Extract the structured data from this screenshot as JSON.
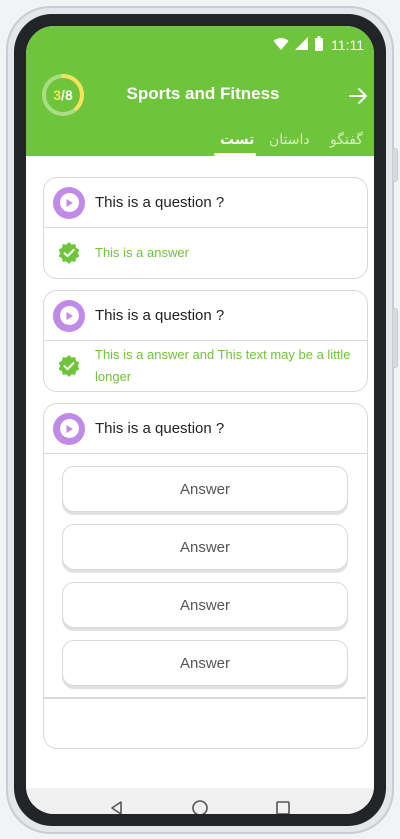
{
  "status_bar": {
    "time": "11:11",
    "icons": [
      "wifi-icon",
      "signal-icon",
      "battery-icon"
    ]
  },
  "header": {
    "progress": {
      "current": "3",
      "total": "8",
      "fraction": 0.375,
      "track_color": "#f7e25b"
    },
    "title": "Sports and Fitness",
    "next_icon": "arrow-right-icon"
  },
  "tabs": [
    {
      "label": "گفتگو",
      "active": false
    },
    {
      "label": "داستان",
      "active": false
    },
    {
      "label": "تست",
      "active": true
    }
  ],
  "cards": [
    {
      "question": "This is a question ?",
      "answer": "This is a answer",
      "answered": true
    },
    {
      "question": "This is a question ?",
      "answer": "This is a answer and This text may be a little longer",
      "answered": true
    },
    {
      "question": "This is a question ?",
      "answered": false,
      "options": [
        "Answer",
        "Answer",
        "Answer",
        "Answer"
      ]
    }
  ],
  "nav_bar": {
    "icons": [
      "back-icon",
      "home-icon",
      "recents-icon"
    ]
  },
  "colors": {
    "brand_green": "#6ec43a",
    "play_purple": "#c08ae8",
    "progress_yellow": "#f7e25b"
  }
}
